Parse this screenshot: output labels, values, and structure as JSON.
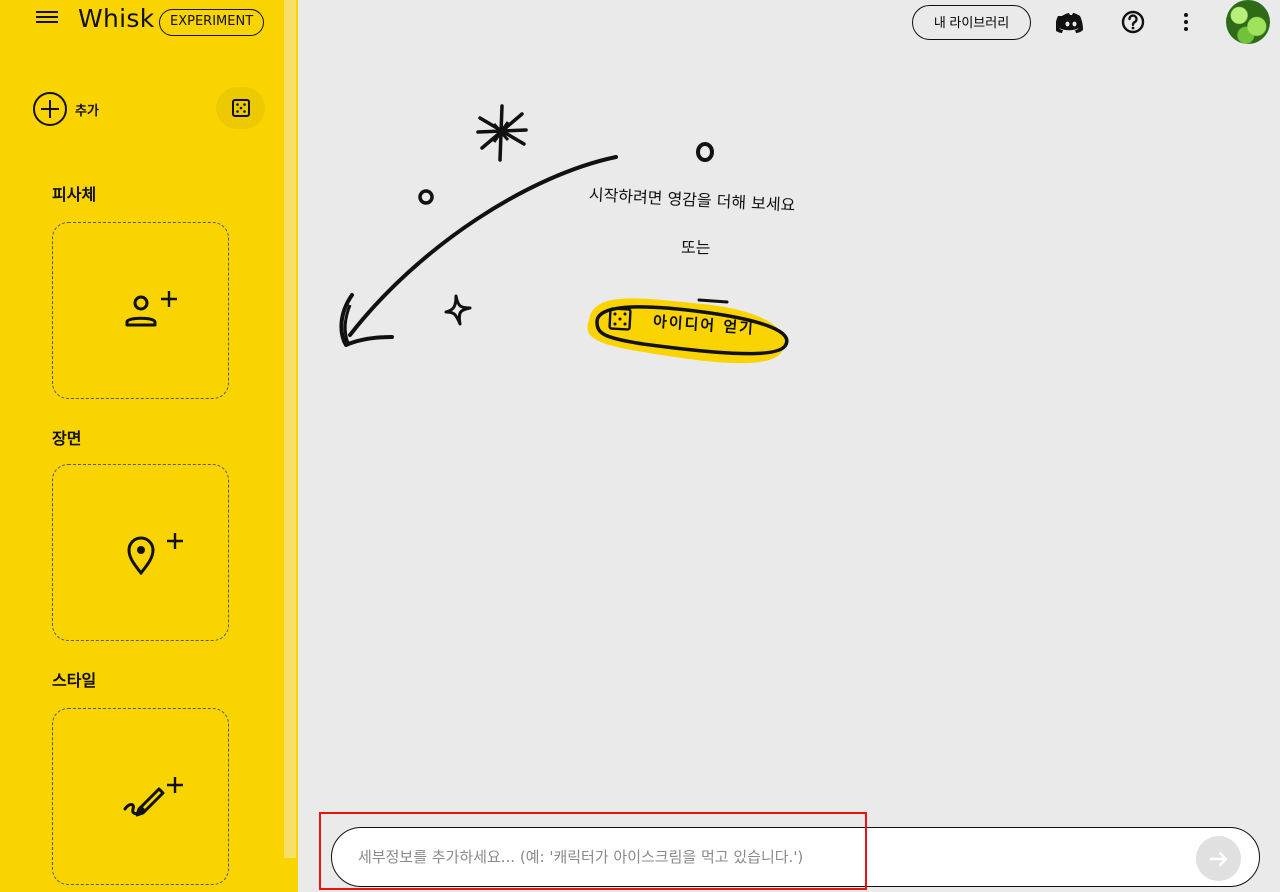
{
  "app": {
    "name": "Whisk",
    "badge": "EXPERIMENT"
  },
  "sidebar": {
    "add_label": "추가",
    "sections": [
      {
        "title": "피사체",
        "icon": "person-add-icon"
      },
      {
        "title": "장면",
        "icon": "location-pin-add-icon"
      },
      {
        "title": "스타일",
        "icon": "brush-add-icon"
      }
    ]
  },
  "header": {
    "library_label": "내 라이브러리",
    "icons": [
      "discord-icon",
      "help-icon",
      "more-vert-icon",
      "avatar"
    ]
  },
  "empty_state": {
    "line1": "시작하려면 영감을 더해 보세요",
    "line2": "또는",
    "idea_button": "아이디어 얻기"
  },
  "prompt": {
    "placeholder": "세부정보를 추가하세요... (예: '캐릭터가 아이스크림을 먹고 있습니다.')",
    "value": ""
  },
  "colors": {
    "accent": "#f9d400",
    "canvas": "#eaeaea",
    "highlight": "#e11111"
  }
}
